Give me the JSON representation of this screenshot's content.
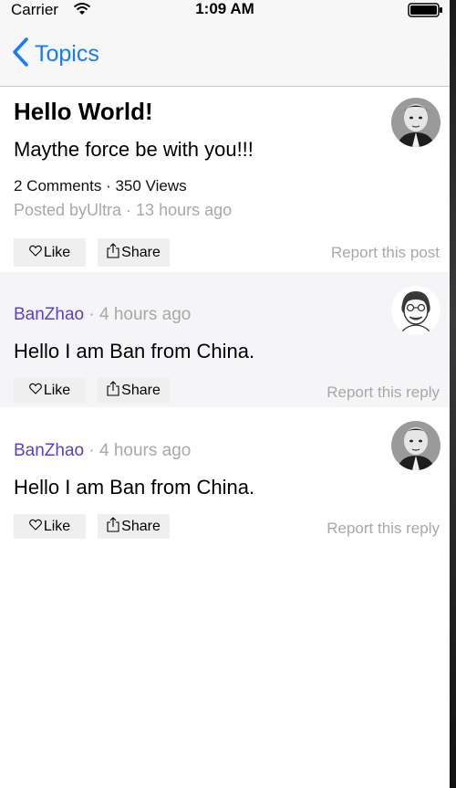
{
  "status_bar": {
    "carrier": "Carrier",
    "time": "1:09 AM"
  },
  "nav": {
    "back_label": "Topics"
  },
  "post": {
    "title": "Hello World!",
    "body": "Maythe force be with you!!!",
    "stats": "2 Comments · 350 Views",
    "meta": "Posted byUltra · 13 hours ago",
    "like_label": "Like",
    "share_label": "Share",
    "report_label": "Report this post"
  },
  "replies": [
    {
      "user": "BanZhao",
      "time": " · 4 hours ago",
      "body": "Hello I am Ban from China.",
      "like_label": "Like",
      "share_label": "Share",
      "report_label": "Report this reply"
    },
    {
      "user": "BanZhao",
      "time": " · 4 hours ago",
      "body": "Hello I am Ban from China.",
      "like_label": "Like",
      "share_label": "Share",
      "report_label": "Report this reply"
    }
  ],
  "colors": {
    "accent": "#1a7cf3",
    "username": "#5a3fc9",
    "muted": "#a8a8a8",
    "reply_bg": "#f5f5f7",
    "button_bg": "#efefef"
  },
  "icons": [
    "wifi-icon",
    "battery-icon",
    "chevron-left-icon",
    "heart-icon",
    "share-icon"
  ]
}
